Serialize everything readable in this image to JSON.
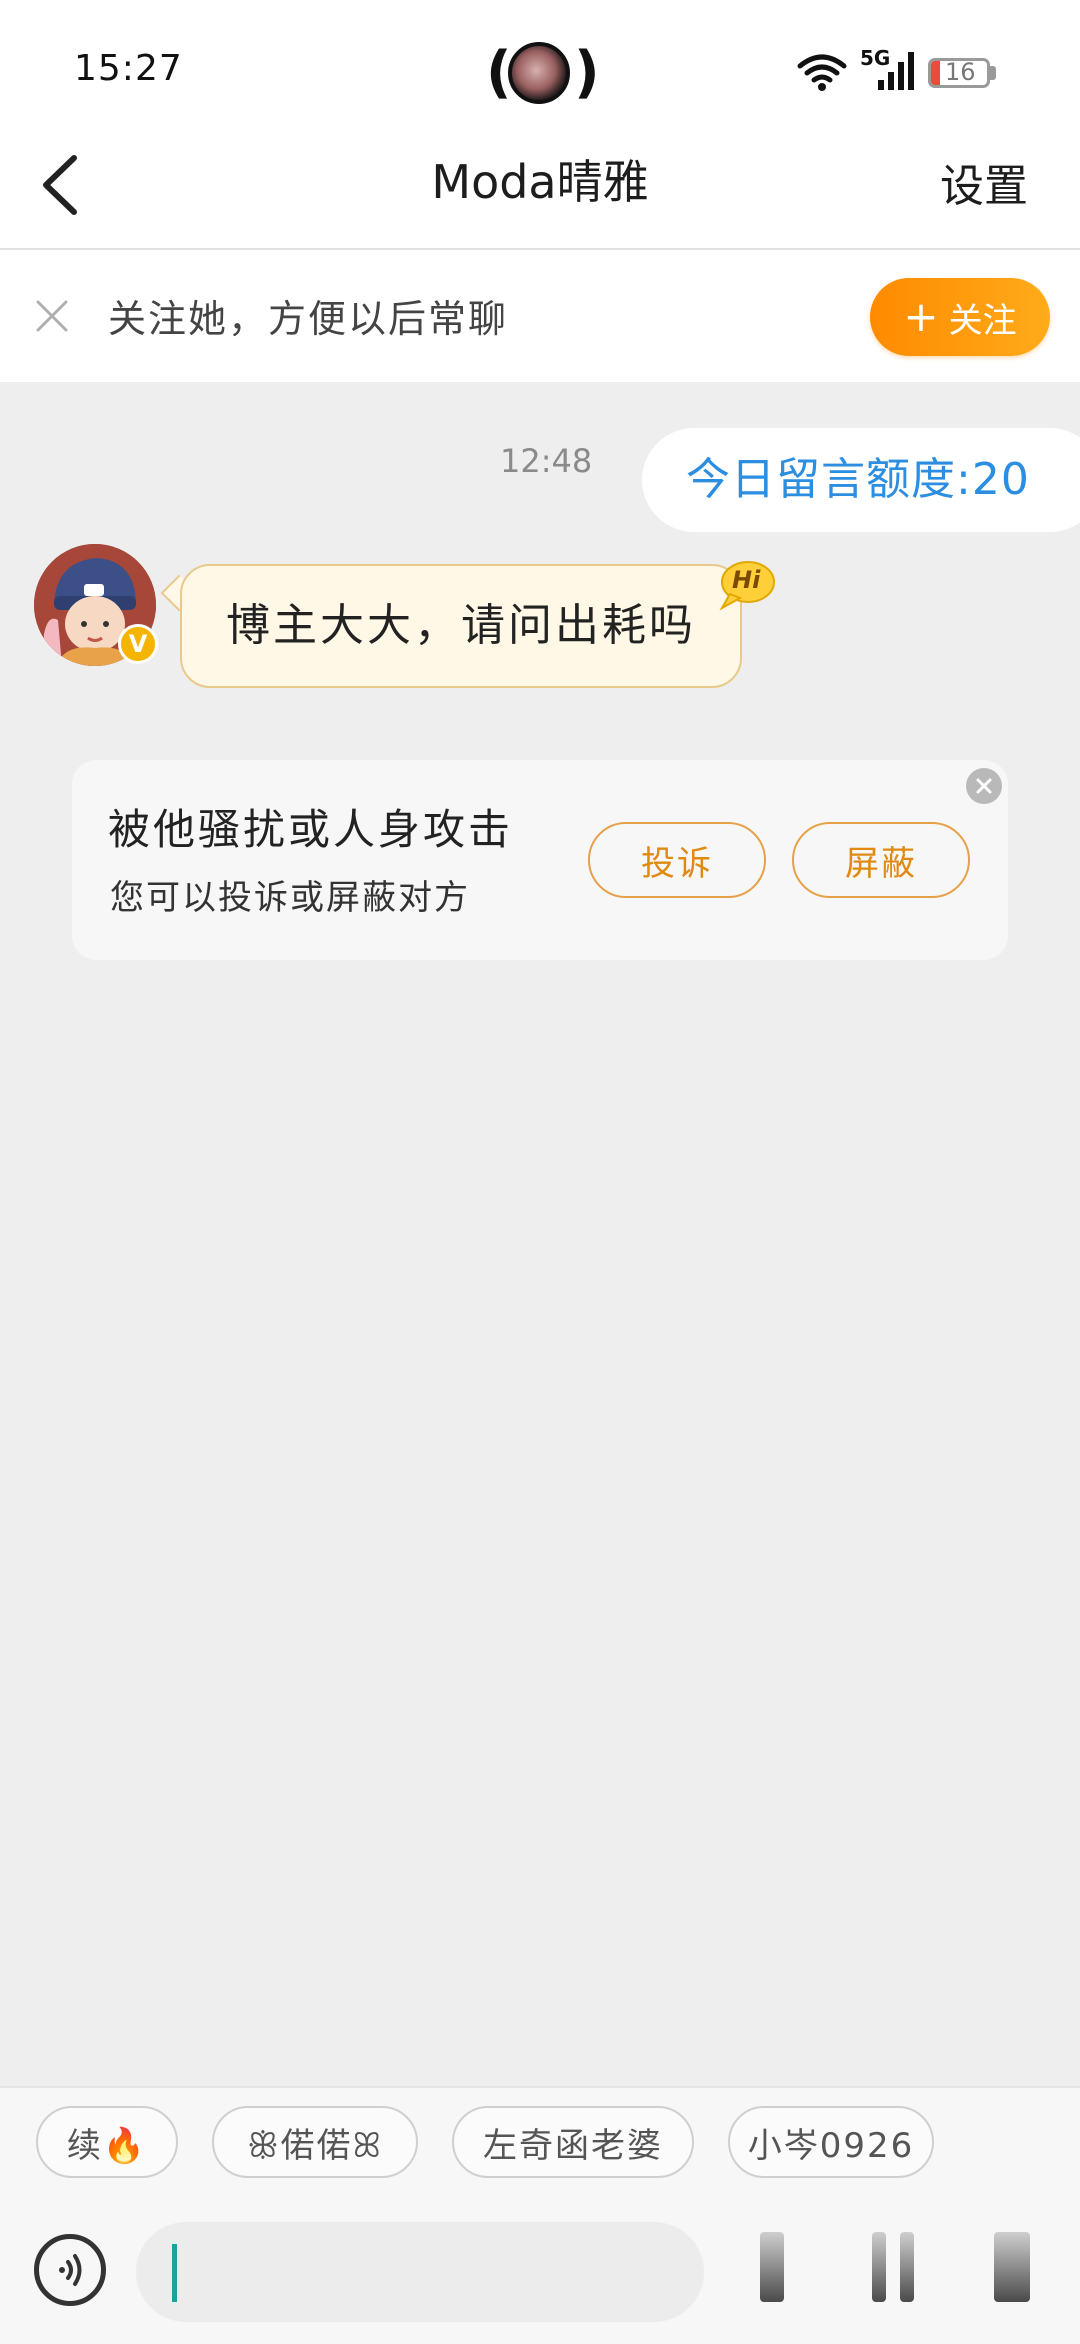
{
  "status_bar": {
    "time": "15:27",
    "network": "5G",
    "battery": "16",
    "battery_fraction": 0.16,
    "battery_color": "#e74c3c"
  },
  "header": {
    "title": "Moda晴雅",
    "settings_label": "设置"
  },
  "follow_banner": {
    "text": "关注她，方便以后常聊",
    "button_label": "关注"
  },
  "conversation": {
    "timestamp": "12:48",
    "quota_text": "今日留言额度:20",
    "incoming_message": "博主大大，请问出耗吗",
    "hi_badge": "Hi",
    "verified_badge": "V"
  },
  "safety_card": {
    "title": "被他骚扰或人身攻击",
    "subtitle": "您可以投诉或屏蔽对方",
    "report_label": "投诉",
    "block_label": "屏蔽"
  },
  "quick_replies": [
    {
      "label": "续🔥"
    },
    {
      "label": "ꕥ偌偌ꕤ"
    },
    {
      "label": "左奇函老婆"
    },
    {
      "label": "小岑0926"
    }
  ],
  "composer": {
    "input_value": "",
    "input_placeholder": ""
  },
  "colors": {
    "accent": "#ff8a00",
    "quota_blue": "#2b8ee0",
    "bubble_bg": "#fff8e6"
  }
}
